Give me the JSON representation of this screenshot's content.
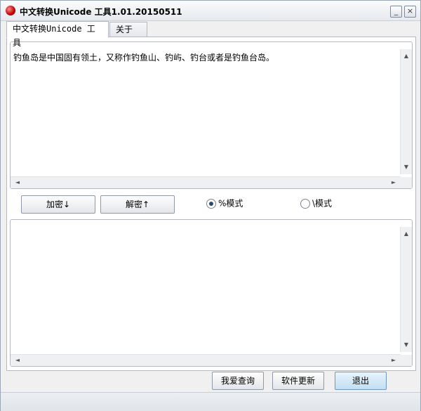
{
  "window": {
    "title": "中文转换Unicode 工具1.01.20150511",
    "minimize_symbol": "_",
    "close_symbol": "×"
  },
  "tabs": [
    {
      "label": "中文转换Unicode 工具"
    },
    {
      "label": "关于"
    }
  ],
  "input": {
    "value": "钓鱼岛是中国固有领土，又称作钓鱼山、钓屿、钓台或者是钓鱼台岛。"
  },
  "output": {
    "value": ""
  },
  "buttons": {
    "encrypt": "加密↓",
    "decrypt": "解密↑",
    "query": "我爱查询",
    "update": "软件更新",
    "exit": "退出"
  },
  "modes": [
    {
      "label": "%模式",
      "selected": true
    },
    {
      "label": "\\模式",
      "selected": false
    }
  ],
  "scroll_glyphs": {
    "up": "▲",
    "down": "▼",
    "left": "◄",
    "right": "►"
  }
}
